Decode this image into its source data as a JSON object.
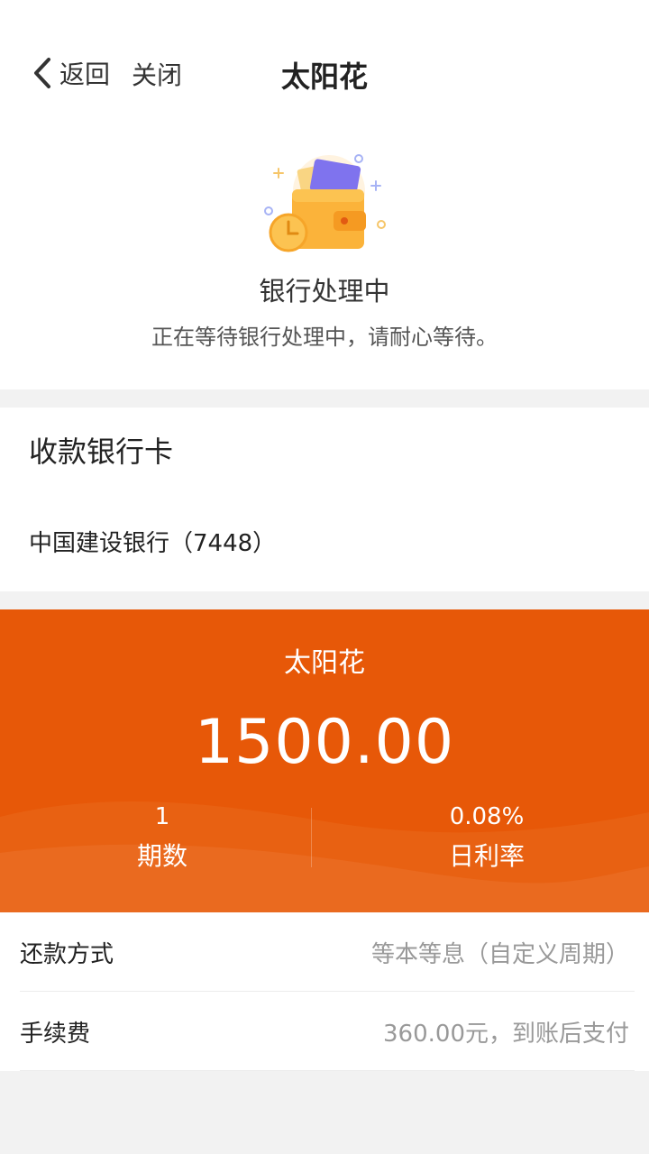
{
  "nav": {
    "back_label": "返回",
    "close_label": "关闭",
    "title": "太阳花"
  },
  "status": {
    "illustration_icon": "wallet-clock-icon",
    "title": "银行处理中",
    "description": "正在等待银行处理中，请耐心等待。"
  },
  "bank": {
    "heading": "收款银行卡",
    "card_name": "中国建设银行（7448）"
  },
  "loan": {
    "product_name": "太阳花",
    "amount": "1500.00",
    "periods_value": "1",
    "periods_label": "期数",
    "daily_rate_value": "0.08%",
    "daily_rate_label": "日利率"
  },
  "details": [
    {
      "label": "还款方式",
      "value": "等本等息（自定义周期）"
    },
    {
      "label": "手续费",
      "value": "360.00元，到账后支付"
    }
  ],
  "colors": {
    "accent": "#e75808",
    "background": "#f2f2f2"
  }
}
